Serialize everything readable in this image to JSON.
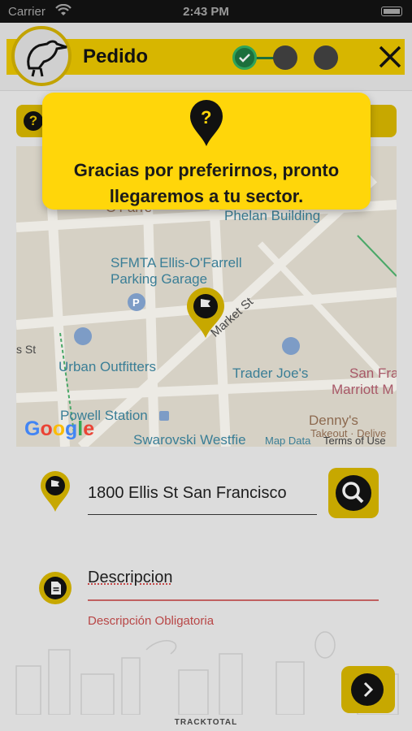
{
  "status_bar": {
    "carrier": "Carrier",
    "time": "2:43 PM"
  },
  "header": {
    "title": "Pedido",
    "steps": [
      "done",
      "pending",
      "pending"
    ]
  },
  "toast": {
    "message": "Gracias por preferirnos, pronto llegaremos a tu sector."
  },
  "map": {
    "labels": {
      "phelan": "Phelan Building",
      "o_farrell": "O'Farre",
      "sfmta": "SFMTA Ellis-O'Farrell",
      "garage": "Parking Garage",
      "s_st": "s St",
      "market": "Market St",
      "urban": "Urban Outfitters",
      "trader": "Trader Joe's",
      "san_fra": "San Fra",
      "marriott": "Marriott M",
      "powell": "Powell Station",
      "dennys": "Denny's",
      "swarovski": "Swarovski Westfie",
      "takeout": "Takeout · Delive"
    },
    "google": "Google",
    "map_data": "Map Data",
    "terms": "Terms of Use"
  },
  "address": {
    "value": "1800 Ellis St San Francisco"
  },
  "description": {
    "placeholder": "Descripcion",
    "error": "Descripción Obligatoria"
  },
  "footer": {
    "brand": "TRACKTOTAL"
  },
  "colors": {
    "accent": "#ffd60a",
    "accent_dim": "#c7a800",
    "step_done": "#1c6f3c",
    "error": "#b84646"
  }
}
